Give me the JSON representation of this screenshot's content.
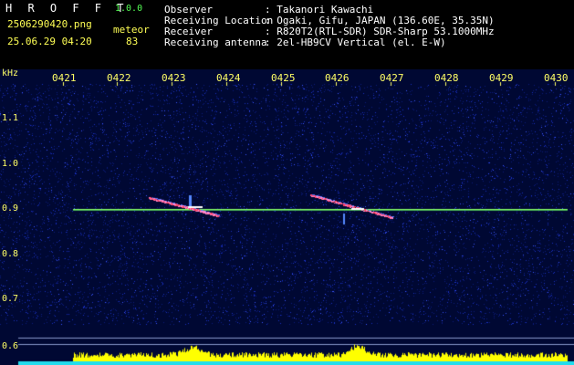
{
  "header": {
    "brand": "H R O F F T",
    "version": "1.0.0",
    "filename": "2506290420.png",
    "mode": "meteor",
    "datetime": "25.06.29 04:20",
    "count": "83",
    "info_labels": [
      "Observer",
      "Receiving Location",
      "Receiver",
      "Receiving antenna"
    ],
    "info_values": [
      ": Takanori Kawachi",
      ": Ogaki, Gifu, JAPAN (136.60E, 35.35N)",
      ": R820T2(RTL-SDR) SDR-Sharp 53.1000MHz",
      ": 2el-HB9CV Vertical (el. E-W)"
    ]
  },
  "spectrogram": {
    "unit": "kHz",
    "freq_ticks": [
      "1.1",
      "1.0",
      "0.9",
      "0.8",
      "0.7",
      "0.6"
    ],
    "time_ticks": [
      "0421",
      "0422",
      "0423",
      "0424",
      "0425",
      "0426",
      "0427",
      "0428",
      "0429",
      "0430"
    ],
    "colors": {
      "background": "#000833",
      "noise": "#1a2fbf",
      "carrier": "#88ff66",
      "echo": "#ff4466",
      "level_bar": "#ffff00",
      "level_base": "#22ddee"
    }
  }
}
